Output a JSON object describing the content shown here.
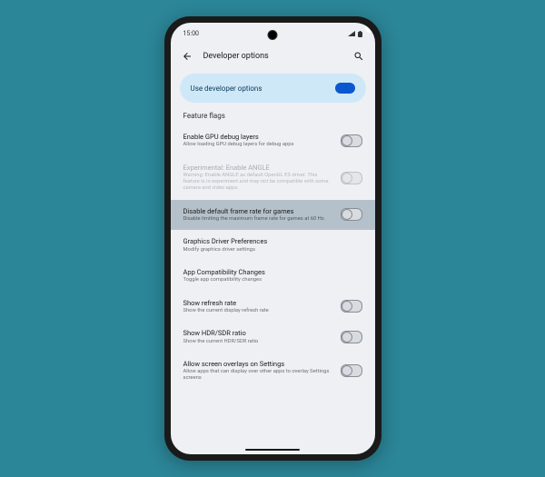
{
  "statusbar": {
    "time": "15:00"
  },
  "appbar": {
    "title": "Developer options"
  },
  "master": {
    "label": "Use developer options",
    "on": true
  },
  "section": "Feature flags",
  "rows": [
    {
      "title": "Enable GPU debug layers",
      "sub": "Allow loading GPU debug layers for debug apps",
      "toggle": "off"
    },
    {
      "title": "Experimental: Enable ANGLE",
      "sub": "Warning: Enable ANGLE as default OpenGL ES driver. This feature is in experiment and may not be compatible with some camera and video apps.",
      "toggle": "off",
      "dim": true
    },
    {
      "title": "Disable default frame rate for games",
      "sub": "Disable limiting the maximum frame rate for games at 60 Hz.",
      "toggle": "off",
      "hl": true
    },
    {
      "title": "Graphics Driver Preferences",
      "sub": "Modify graphics driver settings"
    },
    {
      "title": "App Compatibility Changes",
      "sub": "Toggle app compatibility changes"
    },
    {
      "title": "Show refresh rate",
      "sub": "Show the current display refresh rate",
      "toggle": "off"
    },
    {
      "title": "Show HDR/SDR ratio",
      "sub": "Show the current HDR/SDR ratio",
      "toggle": "off"
    },
    {
      "title": "Allow screen overlays on Settings",
      "sub": "Allow apps that can display over other apps to overlay Settings screens",
      "toggle": "off"
    }
  ]
}
